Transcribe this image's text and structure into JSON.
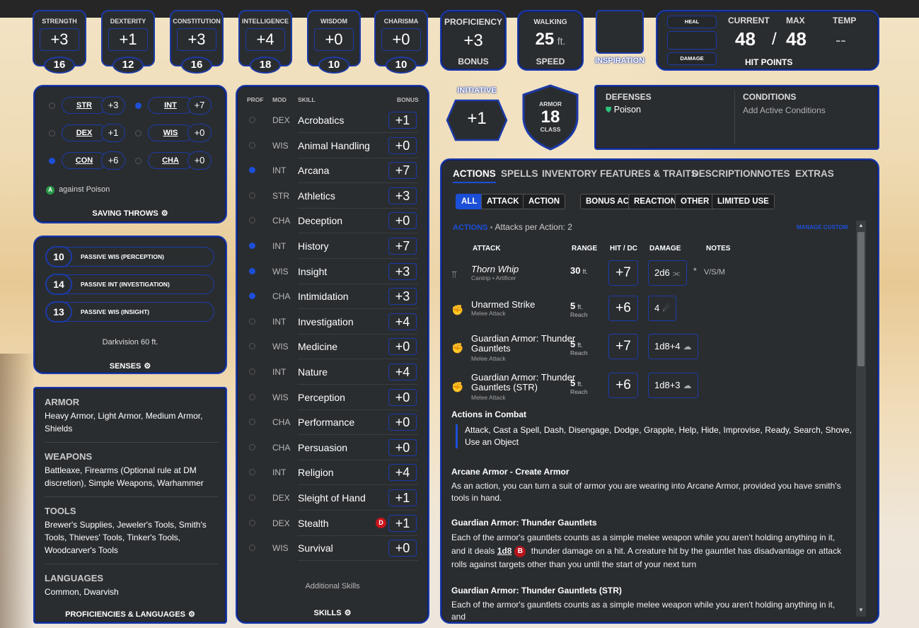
{
  "abilities": [
    {
      "name": "STRENGTH",
      "mod": "+3",
      "score": "16"
    },
    {
      "name": "DEXTERITY",
      "mod": "+1",
      "score": "12"
    },
    {
      "name": "CONSTITUTION",
      "mod": "+3",
      "score": "16"
    },
    {
      "name": "INTELLIGENCE",
      "mod": "+4",
      "score": "18"
    },
    {
      "name": "WISDOM",
      "mod": "+0",
      "score": "10"
    },
    {
      "name": "CHARISMA",
      "mod": "+0",
      "score": "10"
    }
  ],
  "proficiency": {
    "label": "PROFICIENCY",
    "value": "+3",
    "sub": "BONUS"
  },
  "walking": {
    "label": "WALKING",
    "value": "25",
    "unit": "ft.",
    "sub": "SPEED"
  },
  "inspiration": {
    "label": "INSPIRATION"
  },
  "hp": {
    "heal": "HEAL",
    "damage": "DAMAGE",
    "current_label": "CURRENT",
    "max_label": "MAX",
    "temp_label": "TEMP",
    "current": "48",
    "sep": "/",
    "max": "48",
    "temp": "--",
    "title": "HIT POINTS"
  },
  "saves": [
    {
      "abbr": "STR",
      "val": "+3",
      "prof": false
    },
    {
      "abbr": "INT",
      "val": "+7",
      "prof": true
    },
    {
      "abbr": "DEX",
      "val": "+1",
      "prof": false
    },
    {
      "abbr": "WIS",
      "val": "+0",
      "prof": false
    },
    {
      "abbr": "CON",
      "val": "+6",
      "prof": true
    },
    {
      "abbr": "CHA",
      "val": "+0",
      "prof": false
    }
  ],
  "saves_note": {
    "badge": "A",
    "text": "against Poison"
  },
  "saves_title": "SAVING THROWS",
  "senses": {
    "items": [
      {
        "n": "10",
        "t": "PASSIVE WIS (PERCEPTION)"
      },
      {
        "n": "14",
        "t": "PASSIVE INT (INVESTIGATION)"
      },
      {
        "n": "13",
        "t": "PASSIVE WIS (INSIGHT)"
      }
    ],
    "dark": "Darkvision 60 ft.",
    "title": "SENSES"
  },
  "profs": {
    "armor_h": "ARMOR",
    "armor": "Heavy Armor, Light Armor, Medium Armor, Shields",
    "weapons_h": "WEAPONS",
    "weapons": "Battleaxe, Firearms (Optional rule at DM discretion), Simple Weapons, Warhammer",
    "tools_h": "TOOLS",
    "tools": "Brewer's Supplies, Jeweler's Tools, Smith's Tools, Thieves' Tools, Tinker's Tools, Woodcarver's Tools",
    "lang_h": "LANGUAGES",
    "lang": "Common, Dwarvish",
    "title": "PROFICIENCIES & LANGUAGES"
  },
  "skills": {
    "headers": {
      "prof": "PROF",
      "mod": "MOD",
      "skill": "SKILL",
      "bonus": "BONUS"
    },
    "list": [
      {
        "mod": "DEX",
        "name": "Acrobatics",
        "bonus": "+1",
        "prof": false
      },
      {
        "mod": "WIS",
        "name": "Animal Handling",
        "bonus": "+0",
        "prof": false
      },
      {
        "mod": "INT",
        "name": "Arcana",
        "bonus": "+7",
        "prof": true
      },
      {
        "mod": "STR",
        "name": "Athletics",
        "bonus": "+3",
        "prof": false
      },
      {
        "mod": "CHA",
        "name": "Deception",
        "bonus": "+0",
        "prof": false
      },
      {
        "mod": "INT",
        "name": "History",
        "bonus": "+7",
        "prof": true
      },
      {
        "mod": "WIS",
        "name": "Insight",
        "bonus": "+3",
        "prof": true
      },
      {
        "mod": "CHA",
        "name": "Intimidation",
        "bonus": "+3",
        "prof": true
      },
      {
        "mod": "INT",
        "name": "Investigation",
        "bonus": "+4",
        "prof": false
      },
      {
        "mod": "WIS",
        "name": "Medicine",
        "bonus": "+0",
        "prof": false
      },
      {
        "mod": "INT",
        "name": "Nature",
        "bonus": "+4",
        "prof": false
      },
      {
        "mod": "WIS",
        "name": "Perception",
        "bonus": "+0",
        "prof": false
      },
      {
        "mod": "CHA",
        "name": "Performance",
        "bonus": "+0",
        "prof": false
      },
      {
        "mod": "CHA",
        "name": "Persuasion",
        "bonus": "+0",
        "prof": false
      },
      {
        "mod": "INT",
        "name": "Religion",
        "bonus": "+4",
        "prof": false
      },
      {
        "mod": "DEX",
        "name": "Sleight of Hand",
        "bonus": "+1",
        "prof": false
      },
      {
        "mod": "DEX",
        "name": "Stealth",
        "bonus": "+1",
        "prof": false,
        "disadv": "D"
      },
      {
        "mod": "WIS",
        "name": "Survival",
        "bonus": "+0",
        "prof": false
      }
    ],
    "additional": "Additional Skills",
    "title": "SKILLS"
  },
  "initiative": {
    "label": "INITIATIVE",
    "value": "+1"
  },
  "armor_class": {
    "top": "ARMOR",
    "value": "18",
    "bottom": "CLASS"
  },
  "defenses": {
    "title": "DEFENSES",
    "item": "Poison"
  },
  "conditions": {
    "title": "CONDITIONS",
    "placeholder": "Add Active Conditions"
  },
  "tabs": [
    "ACTIONS",
    "SPELLS",
    "INVENTORY",
    "FEATURES & TRAITS",
    "DESCRIPTION",
    "NOTES",
    "EXTRAS"
  ],
  "filters": [
    "ALL",
    "ATTACK",
    "ACTION",
    "BONUS ACTION",
    "REACTION",
    "OTHER",
    "LIMITED USE"
  ],
  "actions": {
    "section": "ACTIONS",
    "dot": "•",
    "per_action": "Attacks per Action: 2",
    "manage": "MANAGE CUSTOM",
    "cols": {
      "attack": "ATTACK",
      "range": "RANGE",
      "hit": "HIT / DC",
      "damage": "DAMAGE",
      "notes": "NOTES"
    },
    "rows": [
      {
        "name": "Thorn Whip",
        "sub": "Cantrip • Artificer",
        "range": "30",
        "range_unit": "ft.",
        "range_sub": "",
        "hit": "+7",
        "dmg": "2d6",
        "dmg_icon": "⫘",
        "star": "*",
        "notes": "V/S/M",
        "icon": "wand-icon"
      },
      {
        "name": "Unarmed Strike",
        "sub": "Melee Attack",
        "range": "5",
        "range_unit": "ft.",
        "range_sub": "Reach",
        "hit": "+6",
        "dmg": "4",
        "dmg_icon": "☄",
        "star": "",
        "notes": "",
        "icon": "fist-icon"
      },
      {
        "name": "Guardian Armor: Thunder Gauntlets",
        "sub": "Melee Attack",
        "range": "5",
        "range_unit": "ft.",
        "range_sub": "Reach",
        "hit": "+7",
        "dmg": "1d8+4",
        "dmg_icon": "☁",
        "star": "",
        "notes": "",
        "icon": "fist-icon"
      },
      {
        "name": "Guardian Armor: Thunder Gauntlets (STR)",
        "sub": "Melee Attack",
        "range": "5",
        "range_unit": "ft.",
        "range_sub": "Reach",
        "hit": "+6",
        "dmg": "1d8+3",
        "dmg_icon": "☁",
        "star": "",
        "notes": "",
        "icon": "fist-icon"
      }
    ],
    "combat_h": "Actions in Combat",
    "combat": "Attack, Cast a Spell, Dash, Disengage, Dodge, Grapple, Help, Hide, Improvise, Ready, Search, Shove, Use an Object",
    "arcane_h": "Arcane Armor - Create Armor",
    "arcane": "As an action, you can turn a suit of armor you are wearing into Arcane Armor, provided you have smith's tools in hand.",
    "tg_h": "Guardian Armor: Thunder Gauntlets",
    "tg1": "Each of the armor's gauntlets counts as a simple melee weapon while you aren't holding anything in it, and it deals",
    "tg_dice": "1d8",
    "tg_badge": "B",
    "tg2": "thunder damage on a hit. A creature hit by the gauntlet has disadvantage on attack rolls against targets other than you until the start of your next turn",
    "tgs_h": "Guardian Armor: Thunder Gauntlets (STR)",
    "tgs": "Each of the armor's gauntlets counts as a simple melee weapon while you aren't holding anything in it, and"
  },
  "colors": {
    "accent": "#1c4fd8",
    "panel": "#2a2d30",
    "border": "#1c3aa8",
    "danger": "#b8141c"
  }
}
